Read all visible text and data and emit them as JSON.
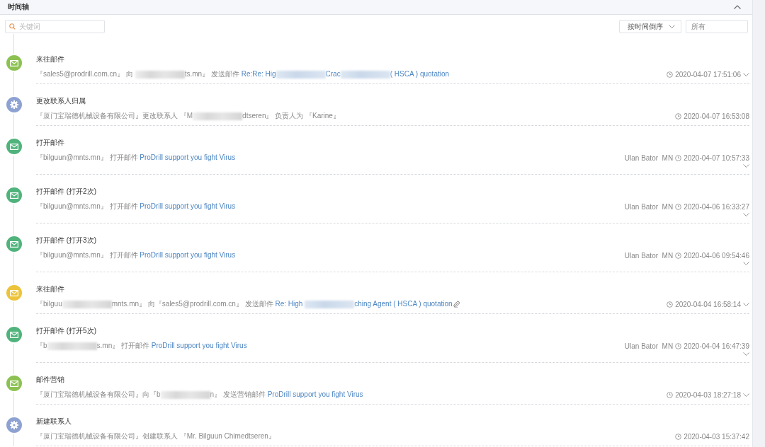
{
  "panel": {
    "title": "时间轴"
  },
  "toolbar": {
    "search": {
      "placeholder": "关键词"
    },
    "sort": {
      "value": "按时间倒序"
    },
    "filter": {
      "placeholder": "所有"
    }
  },
  "events": [
    {
      "kind": "mail",
      "color": "#8cc152",
      "title": "来往邮件",
      "description": [
        {
          "kind": "text",
          "text": "『sales5@prodrill.com.cn』 向 "
        },
        {
          "kind": "redacted"
        },
        {
          "kind": "text",
          "text": "ts.mn』 发送邮件 "
        },
        {
          "kind": "link",
          "text": "Re:Re: Hig"
        },
        {
          "kind": "redacted"
        },
        {
          "kind": "link",
          "text": "Crac"
        },
        {
          "kind": "redacted"
        },
        {
          "kind": "link",
          "text": "( HSCA ) quotation"
        }
      ],
      "attachment": false,
      "time": "2020-04-07 17:51:06",
      "expandable": true
    },
    {
      "kind": "gear",
      "color": "#8ea2d2",
      "title": "更改联系人归属",
      "description": [
        {
          "kind": "text",
          "text": "『厦门宝瑞德机械设备有限公司』更改联系人 『M"
        },
        {
          "kind": "redacted"
        },
        {
          "kind": "text",
          "text": "dtseren』 负责人为 『Karine』"
        }
      ],
      "attachment": false,
      "time": "2020-04-07 16:53:08",
      "expandable": false
    },
    {
      "kind": "mail",
      "color": "#4fb37b",
      "title": "打开邮件",
      "description": [
        {
          "kind": "text",
          "text": "『bilguun@mnts.mn』 打开邮件 "
        },
        {
          "kind": "link",
          "text": "ProDrill support you fight Virus"
        }
      ],
      "attachment": false,
      "location": "Ulan Bator  MN",
      "time": "2020-04-07 10:57:33",
      "expandable": true
    },
    {
      "kind": "mail",
      "color": "#4fb37b",
      "title": "打开邮件 (打开2次)",
      "description": [
        {
          "kind": "text",
          "text": "『bilguun@mnts.mn』 打开邮件 "
        },
        {
          "kind": "link",
          "text": "ProDrill support you fight Virus"
        }
      ],
      "attachment": false,
      "location": "Ulan Bator  MN",
      "time": "2020-04-06 16:33:27",
      "expandable": true
    },
    {
      "kind": "mail",
      "color": "#4fb37b",
      "title": "打开邮件 (打开3次)",
      "description": [
        {
          "kind": "text",
          "text": "『bilguun@mnts.mn』 打开邮件 "
        },
        {
          "kind": "link",
          "text": "ProDrill support you fight Virus"
        }
      ],
      "attachment": false,
      "location": "Ulan Bator  MN",
      "time": "2020-04-06 09:54:46",
      "expandable": true
    },
    {
      "kind": "mail",
      "color": "#ecc33a",
      "title": "来往邮件",
      "description": [
        {
          "kind": "text",
          "text": "『bilguu"
        },
        {
          "kind": "redacted"
        },
        {
          "kind": "text",
          "text": "mnts.mn』 向『sales5@prodrill.com.cn』 发送邮件 "
        },
        {
          "kind": "link",
          "text": "Re: High "
        },
        {
          "kind": "redacted"
        },
        {
          "kind": "link",
          "text": "ching Agent ( HSCA ) quotation"
        }
      ],
      "attachment": true,
      "time": "2020-04-04 16:58:14",
      "expandable": true
    },
    {
      "kind": "mail",
      "color": "#4fb37b",
      "title": "打开邮件 (打开5次)",
      "description": [
        {
          "kind": "text",
          "text": "『b"
        },
        {
          "kind": "redacted"
        },
        {
          "kind": "text",
          "text": "s.mn』 打开邮件 "
        },
        {
          "kind": "link",
          "text": "ProDrill support you fight Virus"
        }
      ],
      "attachment": false,
      "location": "Ulan Bator  MN",
      "time": "2020-04-04 16:47:39",
      "expandable": true
    },
    {
      "kind": "mail",
      "color": "#8cc152",
      "title": "邮件营销",
      "description": [
        {
          "kind": "text",
          "text": "『厦门宝瑞德机械设备有限公司』向『b"
        },
        {
          "kind": "redacted"
        },
        {
          "kind": "text",
          "text": "n』 发送营销邮件 "
        },
        {
          "kind": "link",
          "text": "ProDrill support you fight Virus"
        }
      ],
      "attachment": false,
      "time": "2020-04-03 18:27:18",
      "expandable": true
    },
    {
      "kind": "gear",
      "color": "#8ea2d2",
      "title": "新建联系人",
      "description": [
        {
          "kind": "text",
          "text": "『厦门宝瑞德机械设备有限公司』创建联系人 『Mr. Bilguun Chimedtseren』"
        }
      ],
      "attachment": false,
      "time": "2020-04-03 15:37:42",
      "expandable": false
    }
  ]
}
